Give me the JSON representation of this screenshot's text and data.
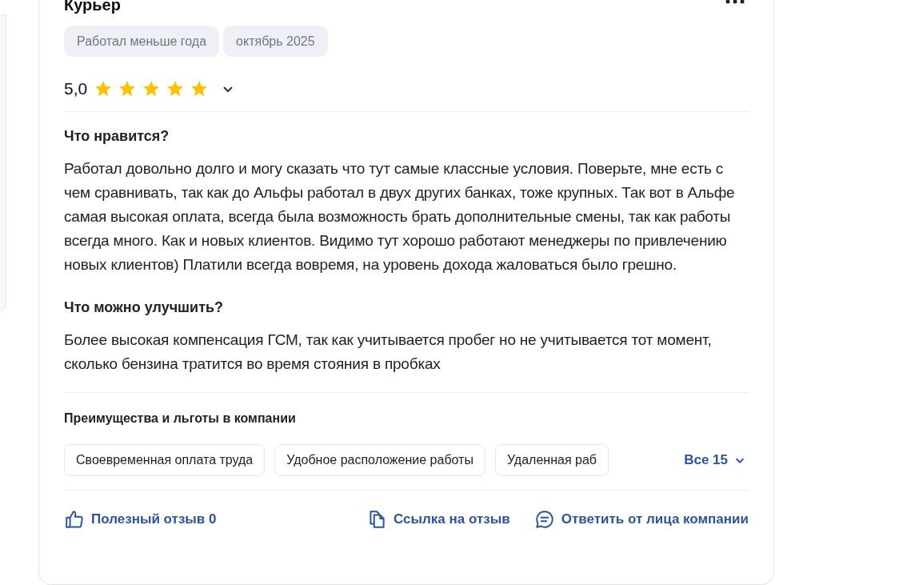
{
  "review": {
    "position": "Курьер",
    "tags": [
      "Работал меньше года",
      "октябрь 2025"
    ],
    "rating": "5,0",
    "stars": 5,
    "sections": [
      {
        "heading": "Что нравится?",
        "text": "Работал довольно долго и могу сказать что тут самые классные условия. Поверьте, мне есть с чем сравнивать, так как до Альфы работал в двух других банках, тоже крупных. Так вот в Альфе самая высокая оплата, всегда была возможность брать дополнительные смены, так как работы всегда много. Как и новых клиентов. Видимо тут хорошо работают менеджеры по привлечению новых клиентов) Платили всегда вовремя, на уровень дохода жаловаться было грешно."
      },
      {
        "heading": "Что можно улучшить?",
        "text": "Более высокая компенсация ГСМ, так как учитывается пробег но не учитывается тот момент, сколько бензина тратится во время стояния в пробках"
      }
    ],
    "benefits": {
      "heading": "Преимущества и льготы в компании",
      "items": [
        "Своевременная оплата труда",
        "Удобное расположение работы",
        "Удаленная раб"
      ],
      "more": "Все 15"
    },
    "actions": [
      {
        "kind": "like",
        "label": "Полезный отзыв 0"
      },
      {
        "kind": "link",
        "label": "Ссылка на отзыв"
      },
      {
        "kind": "reply",
        "label": "Ответить от лица компании"
      }
    ]
  }
}
